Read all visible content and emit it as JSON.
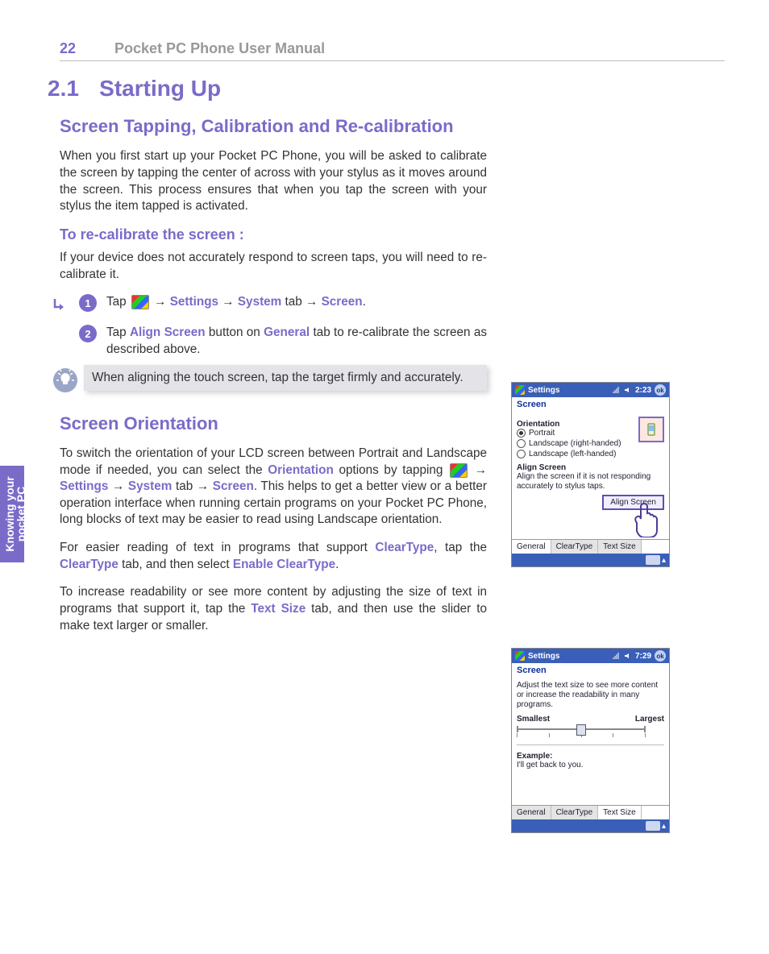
{
  "header": {
    "page_number": "22",
    "doc_title": "Pocket PC Phone User Manual"
  },
  "side_tab": {
    "line1": "Knowing your",
    "line2": "pocket PC"
  },
  "h1": {
    "number": "2.1",
    "title": "Starting Up"
  },
  "calibration": {
    "heading": "Screen Tapping, Calibration and Re-calibration",
    "intro": "When you first start up your Pocket PC Phone, you will be asked to calibrate the screen by tapping the center of across with your stylus as it moves around the screen. This process ensures that when you tap the screen with your stylus the item tapped is activated.",
    "recal_heading": "To re-calibrate the screen :",
    "recal_intro": "If your device does not accurately respond to screen taps, you will need to re-calibrate it.",
    "step1_pre": "Tap ",
    "step1_a": "Settings",
    "step1_b": "System",
    "step1_b_suffix": " tab → ",
    "step1_c": "Screen",
    "step2_pre": "Tap ",
    "step2_a": "Align Screen",
    "step2_mid": " button on ",
    "step2_b": "General",
    "step2_post": " tab to re-calibrate the screen as described above.",
    "tip": "When aligning the touch screen, tap the target firmly and accurately."
  },
  "orientation": {
    "heading": "Screen Orientation",
    "para1_pre": "To switch the orientation of your LCD screen between Portrait and Landscape mode if needed, you can select the ",
    "para1_term1": "Orientation",
    "para1_mid1": " options by tapping ",
    "para1_term2": "Settings",
    "para1_term3": "System",
    "para1_mid2": " tab → ",
    "para1_term4": "Screen",
    "para1_post": ". This helps to get a better view or a better operation interface when running certain programs on your Pocket PC Phone, long blocks of text may be easier to read using Landscape orientation.",
    "para2_pre": "For easier reading of text in programs that support ",
    "para2_term1": "ClearType",
    "para2_mid1": ", tap the ",
    "para2_term2": "ClearType",
    "para2_mid2": " tab, and then select ",
    "para2_term3": "Enable ClearType",
    "para3_pre": "To increase readability or see more content by adjusting the size of text in programs that support it, tap the ",
    "para3_term1": "Text Size",
    "para3_post": " tab, and then use the slider to make text larger or smaller."
  },
  "screen1": {
    "title": "Settings",
    "time": "2:23",
    "app": "Screen",
    "section1": "Orientation",
    "opt1": "Portrait",
    "opt2": "Landscape (right-handed)",
    "opt3": "Landscape (left-handed)",
    "section2": "Align Screen",
    "desc": "Align the screen if it is not responding accurately to stylus taps.",
    "btn": "Align Screen",
    "tabs": {
      "t1": "General",
      "t2": "ClearType",
      "t3": "Text Size"
    }
  },
  "screen2": {
    "title": "Settings",
    "time": "7:29",
    "app": "Screen",
    "desc": "Adjust the text size to see more content or increase the readability in many programs.",
    "smallest": "Smallest",
    "largest": "Largest",
    "example_lbl": "Example:",
    "example_txt": "I'll get back to you.",
    "tabs": {
      "t1": "General",
      "t2": "ClearType",
      "t3": "Text Size"
    }
  }
}
